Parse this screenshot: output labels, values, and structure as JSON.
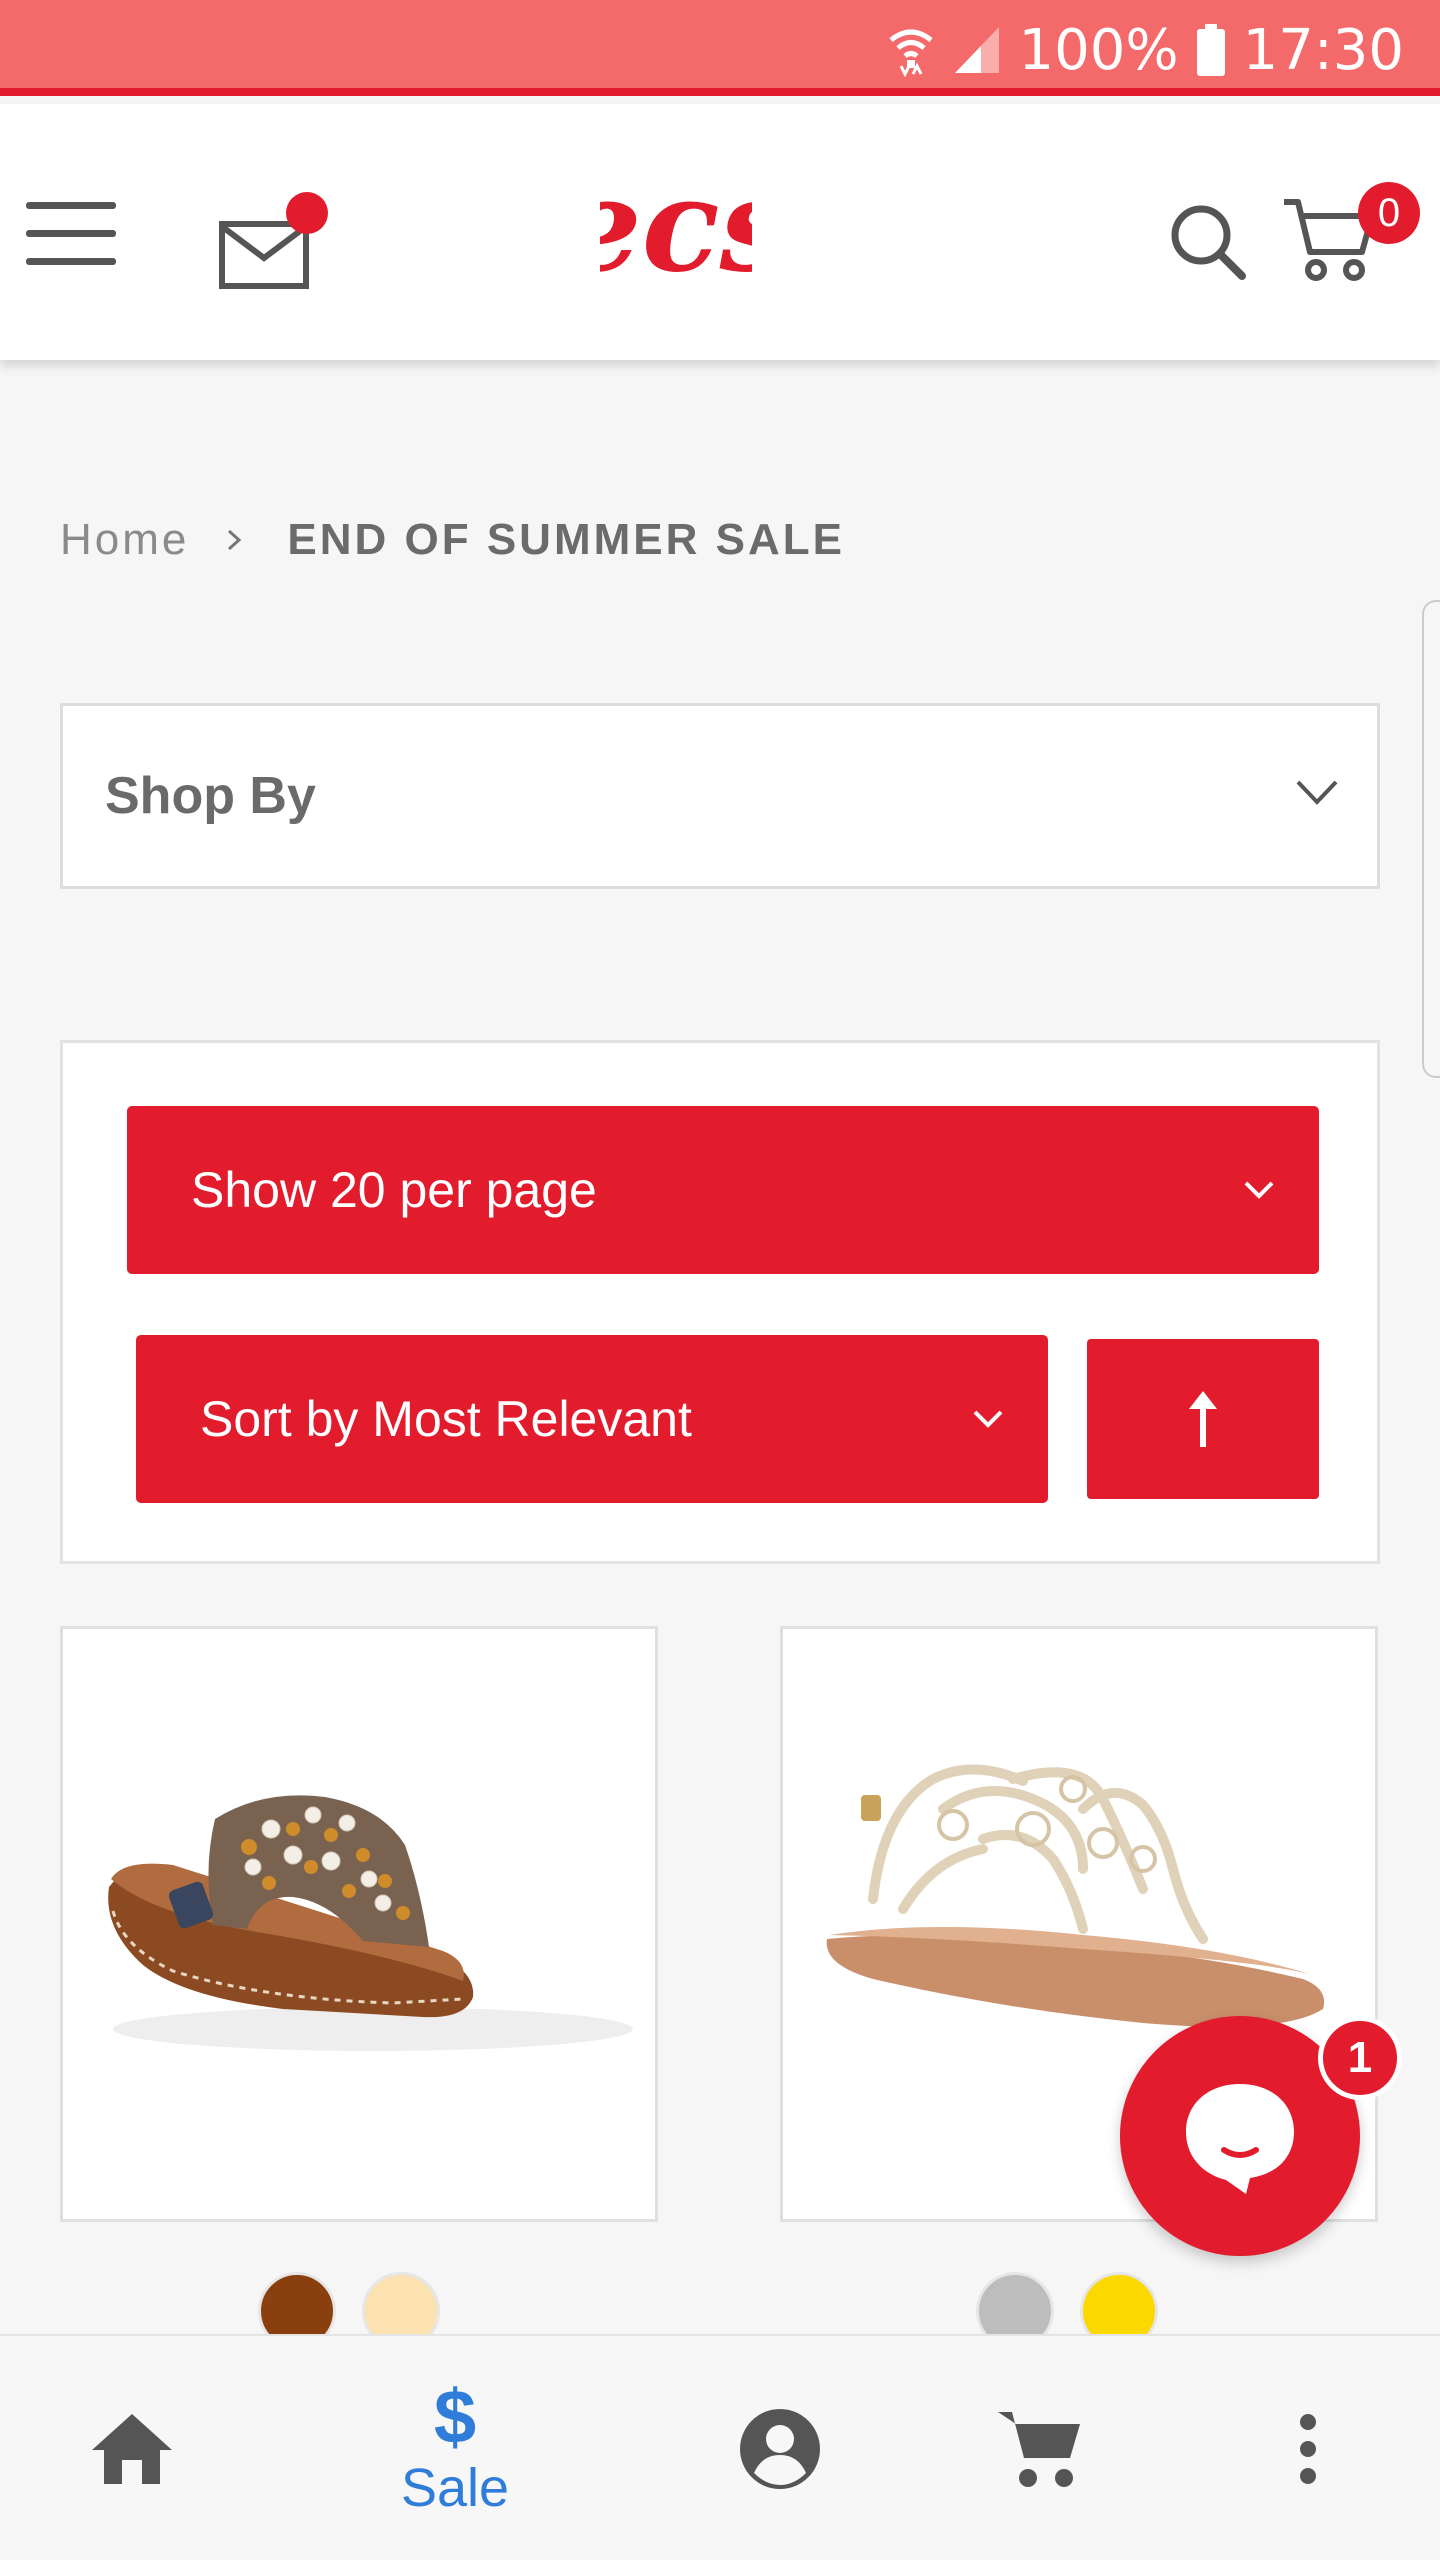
{
  "status_bar": {
    "battery": "100%",
    "time": "17:30",
    "icons": [
      "wifi-icon",
      "signal-icon",
      "battery-icon"
    ]
  },
  "header": {
    "logo": "ecs",
    "cart_count": "0",
    "icons": [
      "menu-icon",
      "mail-icon",
      "search-icon",
      "cart-icon"
    ]
  },
  "breadcrumb": {
    "home": "Home",
    "current": "END OF SUMMER SALE"
  },
  "shop_by": {
    "label": "Shop By"
  },
  "toolbar": {
    "per_page": "Show 20 per page",
    "sort_by": "Sort by Most Relevant"
  },
  "products": [
    {
      "image": "studded-slide-sandal",
      "swatches": [
        "#8a3f0f",
        "#fce2b0"
      ]
    },
    {
      "image": "gold-cutout-thong-sandal",
      "swatches": [
        "#bdbdbd",
        "#fad800"
      ]
    }
  ],
  "chat": {
    "badge": "1"
  },
  "bottom_nav": {
    "sale_label": "Sale",
    "items": [
      "home-icon",
      "sale-dollar-icon",
      "account-icon",
      "cart-icon",
      "more-icon"
    ]
  },
  "colors": {
    "brand_red": "#e21b2d",
    "status_bar": "#f46a6a",
    "nav_active": "#2f7dd9"
  }
}
